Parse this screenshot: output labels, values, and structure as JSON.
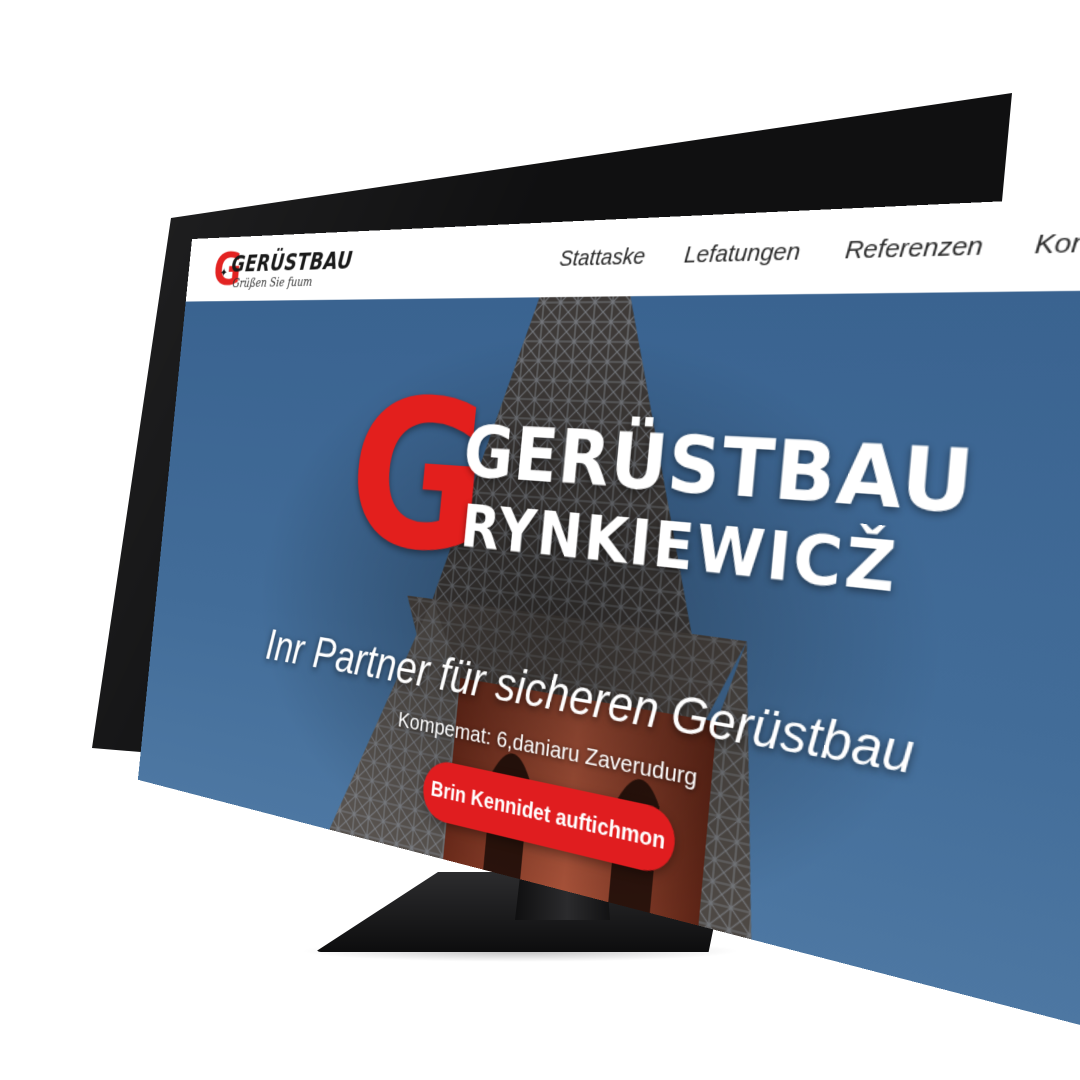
{
  "header": {
    "logo": {
      "title": "GERÜSTBAU",
      "subtitle": "Grüßen Sie fuum"
    },
    "nav": {
      "items": [
        {
          "label": "Stattaske"
        },
        {
          "label": "Lefatungen"
        },
        {
          "label": "Referenzen"
        },
        {
          "label": "Kontakt"
        }
      ]
    }
  },
  "hero": {
    "brand": {
      "letter": "G",
      "line1": "GERÜSTBAU",
      "line2": "RYNKIEWICŽ"
    },
    "headline": "Inr Partner für sicheren Gerüstbau",
    "subline": "Kompemat: 6,daniaru Zaverudurg",
    "cta_label": "Brin Kennidet auftichmon"
  },
  "colors": {
    "accent": "#e31f1d",
    "sky": "#3d6490",
    "header_bg": "#ffffff",
    "text_light": "#ffffff"
  },
  "icons": [
    "logo-scaffold-icon"
  ]
}
